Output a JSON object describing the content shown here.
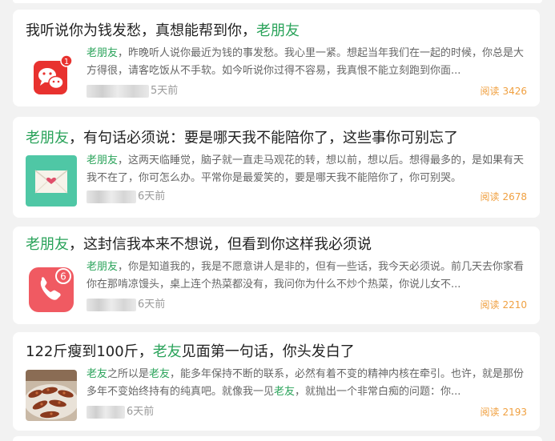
{
  "articles": [
    {
      "title_a": "我听说你为钱发愁，真想能帮到你，",
      "title_hl": "老朋友",
      "title_b": "",
      "snippet_hl": "老朋友",
      "snippet": "，昨晚听人说你最近为钱的事发愁。我心里一紧。想起当年我们在一起的时候，你总是大方得很，请客吃饭从不手软。如今听说你过得不容易，我真恨不能立刻跑到你面...",
      "time": "5天前",
      "reads_label": "阅读",
      "reads_count": "3426",
      "thumb_icon": "chat-icon",
      "badge": "1"
    },
    {
      "title_a": "",
      "title_hl": "老朋友",
      "title_b": "，有句话必须说：要是哪天我不能陪你了，这些事你可别忘了",
      "snippet_hl": "老朋友",
      "snippet": "，这两天临睡觉，脑子就一直走马观花的转，想以前，想以后。想得最多的，是如果有天我不在了，你可怎么办。平常你是最爱笑的，要是哪天我不能陪你了，你可别哭。",
      "time": "6天前",
      "reads_label": "阅读",
      "reads_count": "2678",
      "thumb_icon": "envelope-icon"
    },
    {
      "title_a": "",
      "title_hl": "老朋友",
      "title_b": "，这封信我本来不想说，但看到你这样我必须说",
      "snippet_hl": "老朋友",
      "snippet": "，你是知道我的，我是不愿意讲人是非的，但有一些话，我今天必须说。前几天去你家看你在那啃凉馒头，桌上连个热菜都没有，我问你为什么不炒个热菜，你说儿女不...",
      "time": "6天前",
      "reads_label": "阅读",
      "reads_count": "2210",
      "thumb_icon": "phone-icon",
      "badge": "6"
    },
    {
      "title_a": "122斤瘦到100斤，",
      "title_hl": "老友",
      "title_b": "见面第一句话，你头发白了",
      "snippet_hl": "老友",
      "snippet_mid_a": "之所以是",
      "snippet_hl2": "老友",
      "snippet_mid_b": "，能多年保持不断的联系，必然有着不变的精神内核在牵引。也许，就是那份多年不变始终持有的纯真吧。就像我一见",
      "snippet_hl3": "老友",
      "snippet_end": "，就抛出一个非常白痴的问题：你...",
      "time": "6天前",
      "reads_label": "阅读",
      "reads_count": "2193",
      "thumb_icon": "food-photo"
    }
  ]
}
